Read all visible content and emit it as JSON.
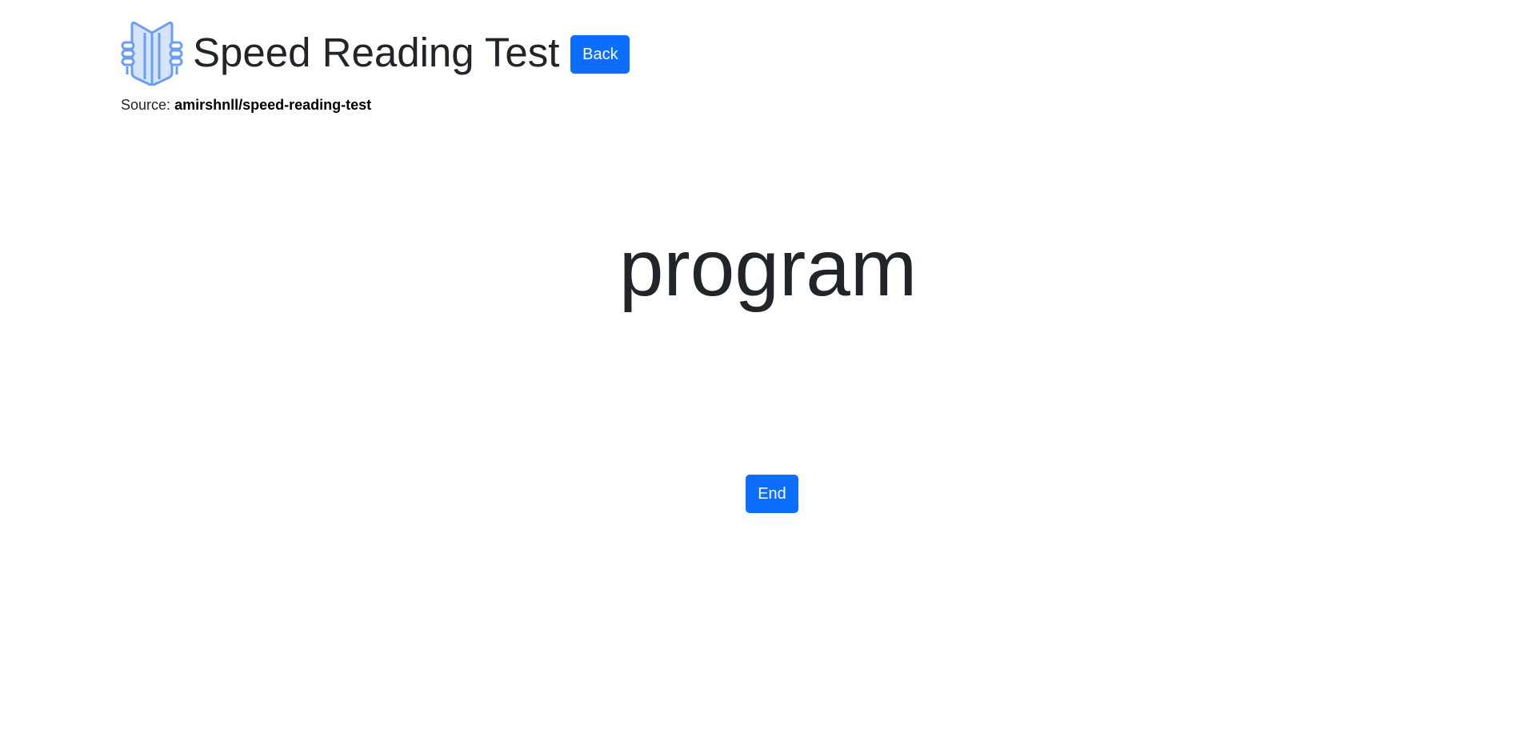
{
  "header": {
    "logo_icon": "open-book-icon",
    "title": "Speed Reading Test",
    "back_label": "Back"
  },
  "source": {
    "label": "Source:",
    "repo": "amirshnll/speed-reading-test"
  },
  "reader": {
    "current_word": "program",
    "end_label": "End"
  },
  "colors": {
    "accent": "#0d6efd",
    "logo_stroke": "#6a9ef5",
    "logo_fill": "#d6e4fb",
    "text": "#212529"
  }
}
